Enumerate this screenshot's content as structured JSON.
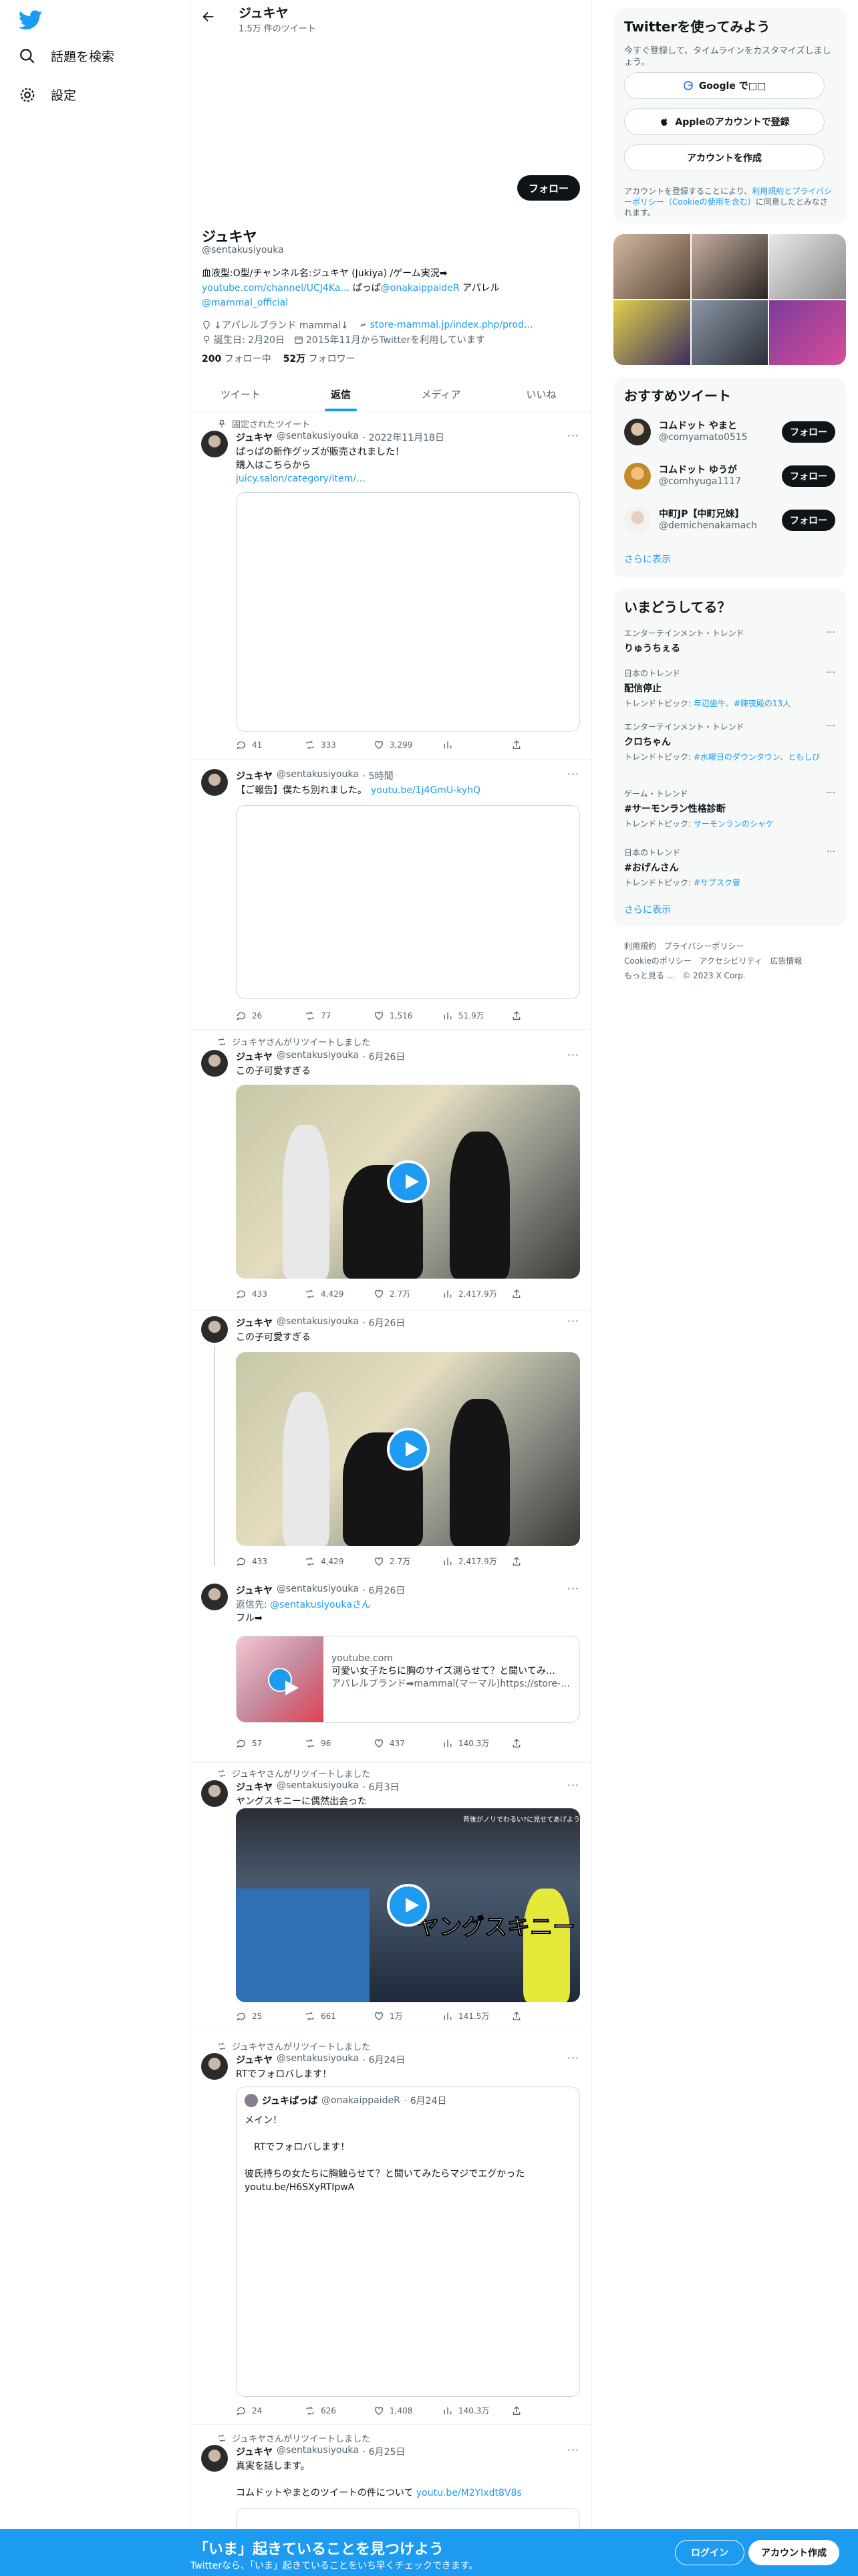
{
  "nav": {
    "explore": "話題を検索",
    "settings": "設定"
  },
  "header": {
    "name": "ジュキヤ",
    "tweet_count": "1.5万 件のツイート"
  },
  "profile": {
    "follow_label": "フォロー",
    "name": "ジュキヤ",
    "handle": "@sentakusiyouka",
    "bio_line1": "血液型:O型/チャンネル名:ジュキヤ (Jukiya) /ゲーム実況➡",
    "bio_link1": "youtube.com/channel/UCJ4Ka…",
    "bio_mid": " ぱっぱ",
    "bio_mention": "@onakaippaideR",
    "bio_after": " アパレル",
    "bio_mention2": "@mammal_official",
    "meta_brand": "↓アパレルブランド mammal↓",
    "meta_link": "store-mammal.jp/index.php/prod…",
    "meta_birthday": "誕生日: 2月20日",
    "meta_joined": "2015年11月からTwitterを利用しています",
    "following_count": "200",
    "following_label": "フォロー中",
    "followers_count": "52万",
    "followers_label": "フォロワー"
  },
  "tabs": [
    "ツイート",
    "返信",
    "メディア",
    "いいね"
  ],
  "tweets": [
    {
      "social": "固定されたツイート",
      "name": "ジュキヤ",
      "handle": "@sentakusiyouka",
      "time": "· 2022年11月18日",
      "text": "ぱっぱの新作グッズが販売されました！\n購入はこちらから",
      "link": "juicy.salon/category/item/…",
      "reply": "41",
      "retweet": "333",
      "like": "3,299",
      "views": ""
    },
    {
      "social": "",
      "name": "ジュキヤ",
      "handle": "@sentakusiyouka",
      "time": "· 5時間",
      "text": "【ご報告】僕たち別れました。",
      "link": "youtu.be/1j4GmU-kyhQ",
      "reply": "26",
      "retweet": "77",
      "like": "1,516",
      "views": "51.9万"
    },
    {
      "social": "ジュキヤさんがリツイートしました",
      "name": "ジュキヤ",
      "handle": "@sentakusiyouka",
      "time": "· 6月26日",
      "text": "この子可愛すぎる",
      "reply": "433",
      "retweet": "4,429",
      "like": "2.7万",
      "views": "2,417.9万"
    },
    {
      "social": "",
      "name": "ジュキヤ",
      "handle": "@sentakusiyouka",
      "time": "· 6月26日",
      "text": "この子可愛すぎる",
      "reply": "433",
      "retweet": "4,429",
      "like": "2.7万",
      "views": "2,417.9万"
    },
    {
      "social": "",
      "name": "ジュキヤ",
      "handle": "@sentakusiyouka",
      "time": "· 6月26日",
      "reply_to": "返信先: ",
      "reply_to_handle": "@sentakusiyoukaさん",
      "text": "フル➡",
      "card_domain": "youtube.com",
      "card_title": "可愛い女子たちに胸のサイズ測らせて？と聞いてみ…",
      "card_desc": "アパレルブランド➡mammal(マーマル)https://store-…",
      "reply": "57",
      "retweet": "96",
      "like": "437",
      "views": "140.3万"
    },
    {
      "social": "ジュキヤさんがリツイートしました",
      "name": "ジュキヤ",
      "handle": "@sentakusiyouka",
      "time": "· 6月3日",
      "text": "ヤングスキニーに偶然出会った",
      "overlay_top": "背後がノリでわるい?に見せてあげよう",
      "overlay_big": "ヤングスキニー",
      "reply": "25",
      "retweet": "661",
      "like": "1万",
      "views": "141.5万"
    },
    {
      "social": "ジュキヤさんがリツイートしました",
      "name": "ジュキヤ",
      "handle": "@sentakusiyouka",
      "time": "· 6月24日",
      "text": "RTでフォロバします！",
      "quote_name": "ジュキぱっぱ",
      "quote_handle": "@onakaippaideR",
      "quote_time": "· 6月24日",
      "quote_text": "メイン！\n\n　RTでフォロバします！\n\n彼氏持ちの女たちに胸触らせて？と聞いてみたらマジでエグかった\nyoutu.be/H6SXyRTIpwA",
      "reply": "24",
      "retweet": "626",
      "like": "1,408",
      "views": "140.3万"
    },
    {
      "social": "ジュキヤさんがリツイートしました",
      "name": "ジュキヤ",
      "handle": "@sentakusiyouka",
      "time": "· 6月25日",
      "text": "真実を話します。\n\nコムドットやまとのツイートの件について ",
      "link": "youtu.be/M2YIxdt8V8s"
    }
  ],
  "right": {
    "signup_title": "Twitterを使ってみよう",
    "signup_desc": "今すぐ登録して、タイムラインをカスタマイズしましょう。",
    "google_btn": "Google で□□",
    "apple_btn": "Appleのアカウントで登録",
    "create_btn": "アカウントを作成",
    "legal_pre": "アカウントを登録することにより、",
    "legal_link": "利用規約とプライバシーポリシー（Cookieの使用を含む）",
    "legal_post": "に同意したとみなされます。",
    "wtf_title": "おすすめツイート",
    "wtf": [
      {
        "name": "コムドット やまと",
        "handle": "@comyamato0515",
        "follow": "フォロー"
      },
      {
        "name": "コムドット ゆうが",
        "handle": "@comhyuga1117",
        "follow": "フォロー"
      },
      {
        "name": "中町JP【中町兄妹】",
        "handle": "@demichenakamach",
        "follow": "フォロー"
      }
    ],
    "show_more": "さらに表示",
    "trends_title": "いまどうしてる？",
    "trends": [
      {
        "category": "エンターテインメント・トレンド",
        "name": "りゅうちぇる",
        "sub": "",
        "sub_link": ""
      },
      {
        "category": "日本のトレンド",
        "name": "配信停止",
        "sub": "トレンドトピック: ",
        "sub_link": "年辺歯牛、#陳夜殿の13人"
      },
      {
        "category": "エンターテインメント・トレンド",
        "name": "クロちゃん",
        "sub": "トレンドトピック: ",
        "sub_link": "#水曜日のダウンタウン、ともしび"
      },
      {
        "category": "ゲーム・トレンド",
        "name": "#サーモンラン性格診断",
        "sub": "トレンドトピック: ",
        "sub_link": "サーモンランのシャケ"
      },
      {
        "category": "日本のトレンド",
        "name": "#おげんさん",
        "sub": "トレンドトピック: ",
        "sub_link": "#サブスク曽"
      }
    ],
    "trends_more": "さらに表示",
    "footer": [
      "利用規約",
      "プライバシーポリシー",
      "Cookieのポリシー",
      "アクセシビリティ",
      "広告情報",
      "もっと見る …",
      "© 2023 X Corp."
    ]
  },
  "bottom": {
    "title": "「いま」起きていることを見つけよう",
    "subtitle": "Twitterなら、「いま」起きていることをいち早くチェックできます。",
    "login": "ログイン",
    "signup": "アカウント作成"
  }
}
